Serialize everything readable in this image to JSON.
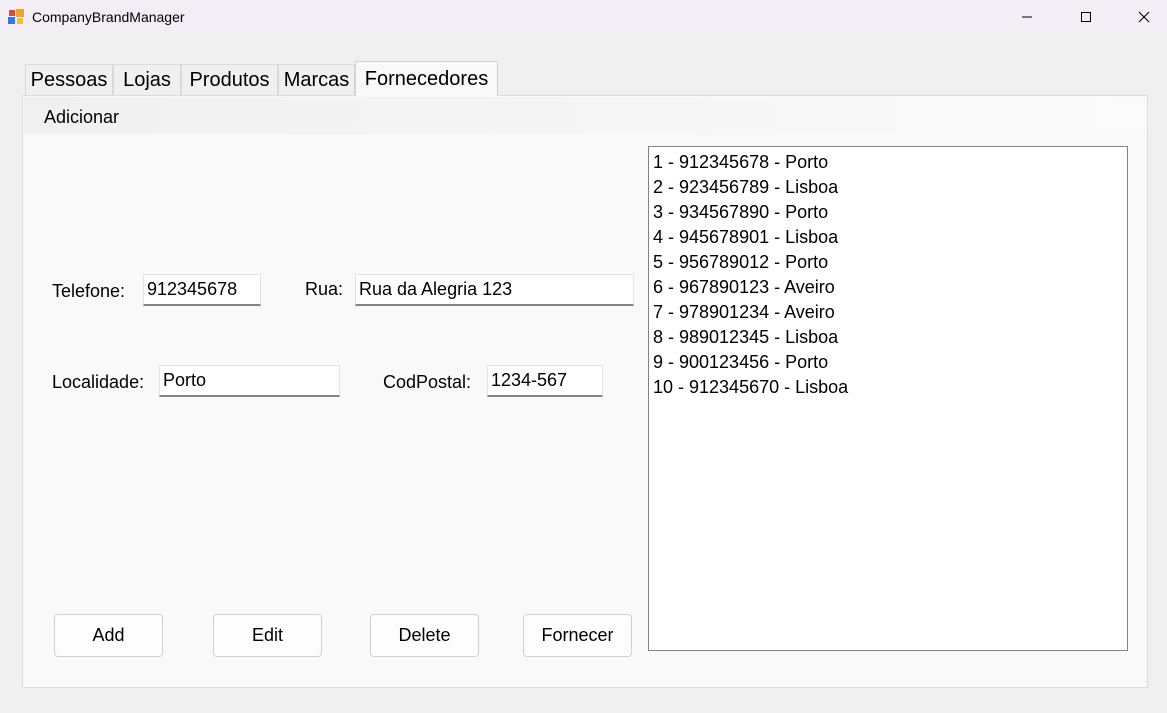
{
  "window": {
    "title": "CompanyBrandManager"
  },
  "tabs": [
    {
      "label": "Pessoas"
    },
    {
      "label": "Lojas"
    },
    {
      "label": "Produtos"
    },
    {
      "label": "Marcas"
    },
    {
      "label": "Fornecedores"
    }
  ],
  "active_tab": "Fornecedores",
  "menu": {
    "add_label": "Adicionar"
  },
  "form": {
    "telefone": {
      "label": "Telefone:",
      "value": "912345678"
    },
    "rua": {
      "label": "Rua:",
      "value": "Rua da Alegria 123"
    },
    "localidade": {
      "label": "Localidade:",
      "value": "Porto"
    },
    "codpostal": {
      "label": "CodPostal:",
      "value": "1234-567"
    }
  },
  "list": {
    "items": [
      "1 - 912345678 - Porto",
      "2 - 923456789 - Lisboa",
      "3 - 934567890 - Porto",
      "4 - 945678901 - Lisboa",
      "5 - 956789012 - Porto",
      "6 - 967890123 - Aveiro",
      "7 - 978901234 - Aveiro",
      "8 - 989012345 - Lisboa",
      "9 - 900123456 - Porto",
      "10 - 912345670 - Lisboa"
    ]
  },
  "buttons": {
    "add": "Add",
    "edit": "Edit",
    "delete": "Delete",
    "fornecer": "Fornecer"
  },
  "icons": {
    "app": "app-icon",
    "minimize": "minimize-icon",
    "maximize": "maximize-icon",
    "close": "close-icon"
  }
}
